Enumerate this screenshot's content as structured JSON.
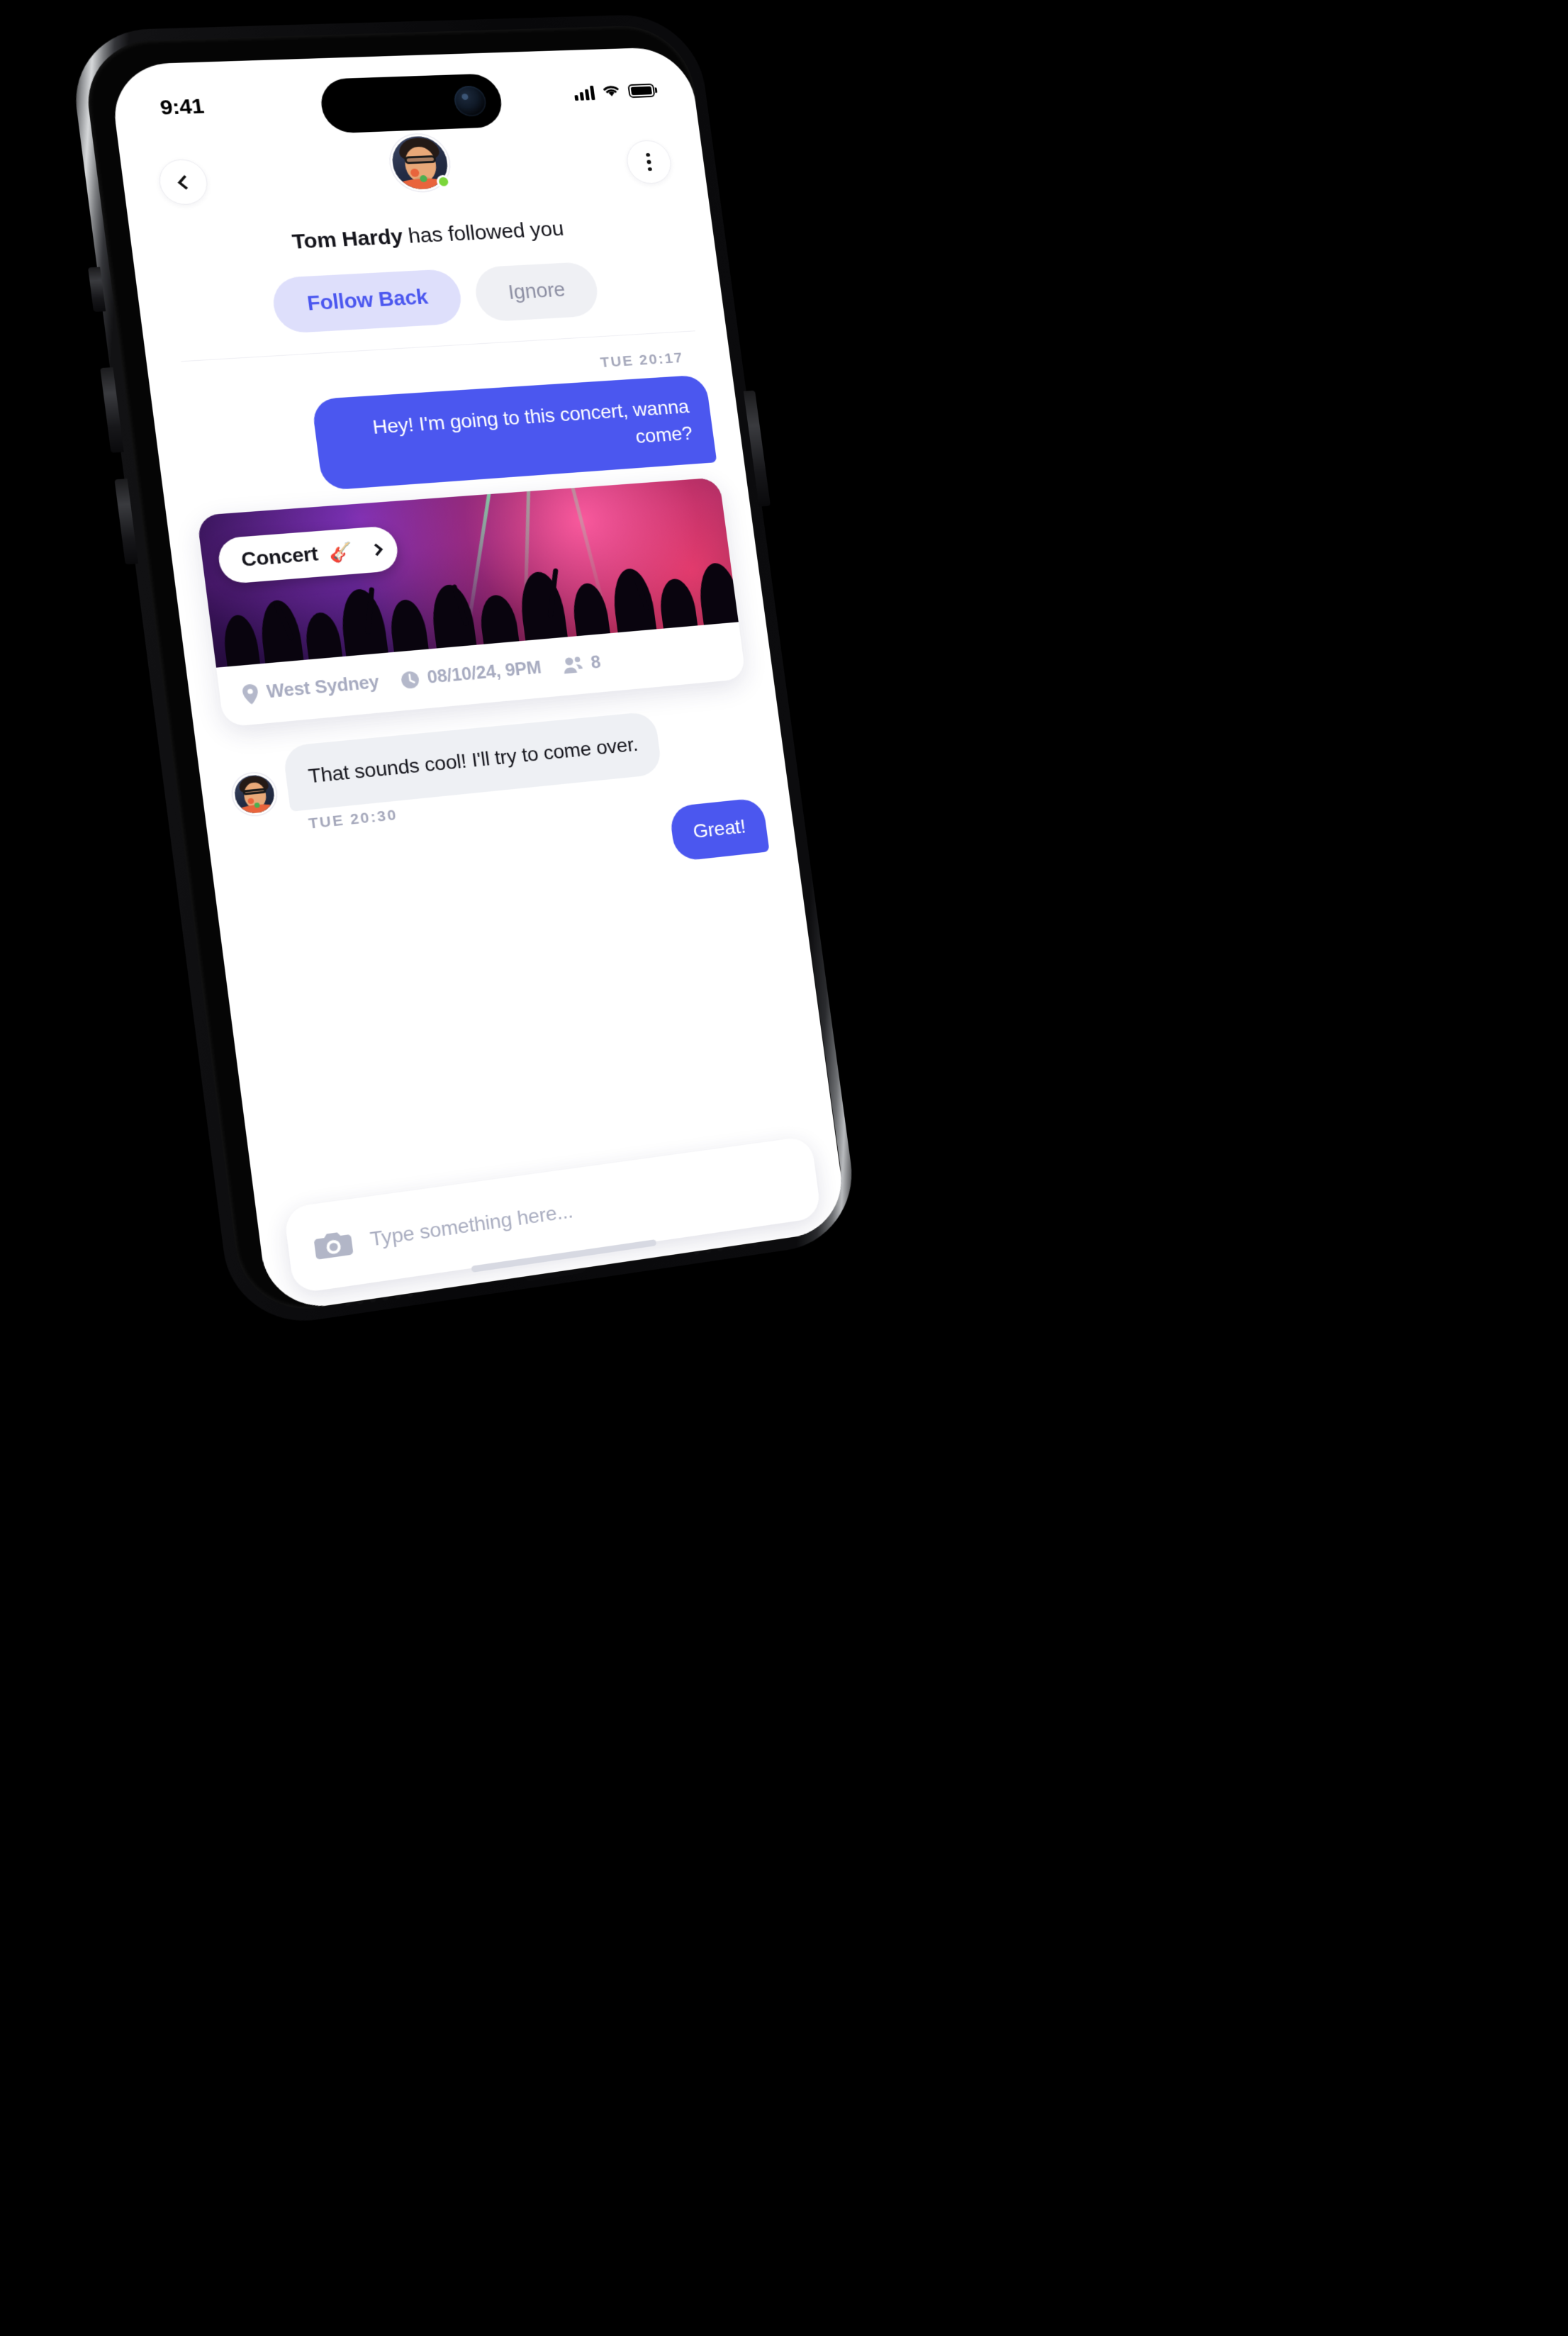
{
  "status_bar": {
    "time": "9:41",
    "signal_icon": "cellular-signal-icon",
    "wifi_icon": "wifi-icon",
    "battery_icon": "battery-icon"
  },
  "nav": {
    "back_icon": "chevron-left-icon",
    "more_icon": "kebab-menu-icon",
    "avatar_name": "avatar",
    "presence": "online"
  },
  "follow_banner": {
    "name": "Tom Hardy",
    "suffix": " has followed you",
    "follow_back_label": "Follow Back",
    "ignore_label": "Ignore"
  },
  "thread": {
    "timestamp_1": "TUE 20:17",
    "timestamp_2": "TUE 20:30",
    "messages": [
      {
        "id": "m1",
        "side": "out",
        "text": "Hey! I'm going to this concert, wanna come?"
      },
      {
        "id": "m2",
        "side": "in",
        "text": "That sounds cool! I'll try to come over."
      },
      {
        "id": "m3",
        "side": "out",
        "text": "Great!"
      }
    ]
  },
  "event_card": {
    "chip_label": "Concert",
    "chip_emoji": "🎸",
    "chip_chevron_icon": "chevron-right-icon",
    "location_icon": "location-pin-icon",
    "location": "West Sydney",
    "time_icon": "clock-icon",
    "datetime": "08/10/24, 9PM",
    "attendees_icon": "people-icon",
    "attendees": "8"
  },
  "composer": {
    "camera_icon": "camera-icon",
    "placeholder": "Type something here..."
  },
  "colors": {
    "accent_blue": "#4b57ef",
    "follow_back_bg": "#dedffb",
    "ignore_bg": "#eff0f4",
    "incoming_bubble_bg": "#eef0f4",
    "muted_text": "#a7abc0",
    "online_green": "#7bd63a"
  }
}
